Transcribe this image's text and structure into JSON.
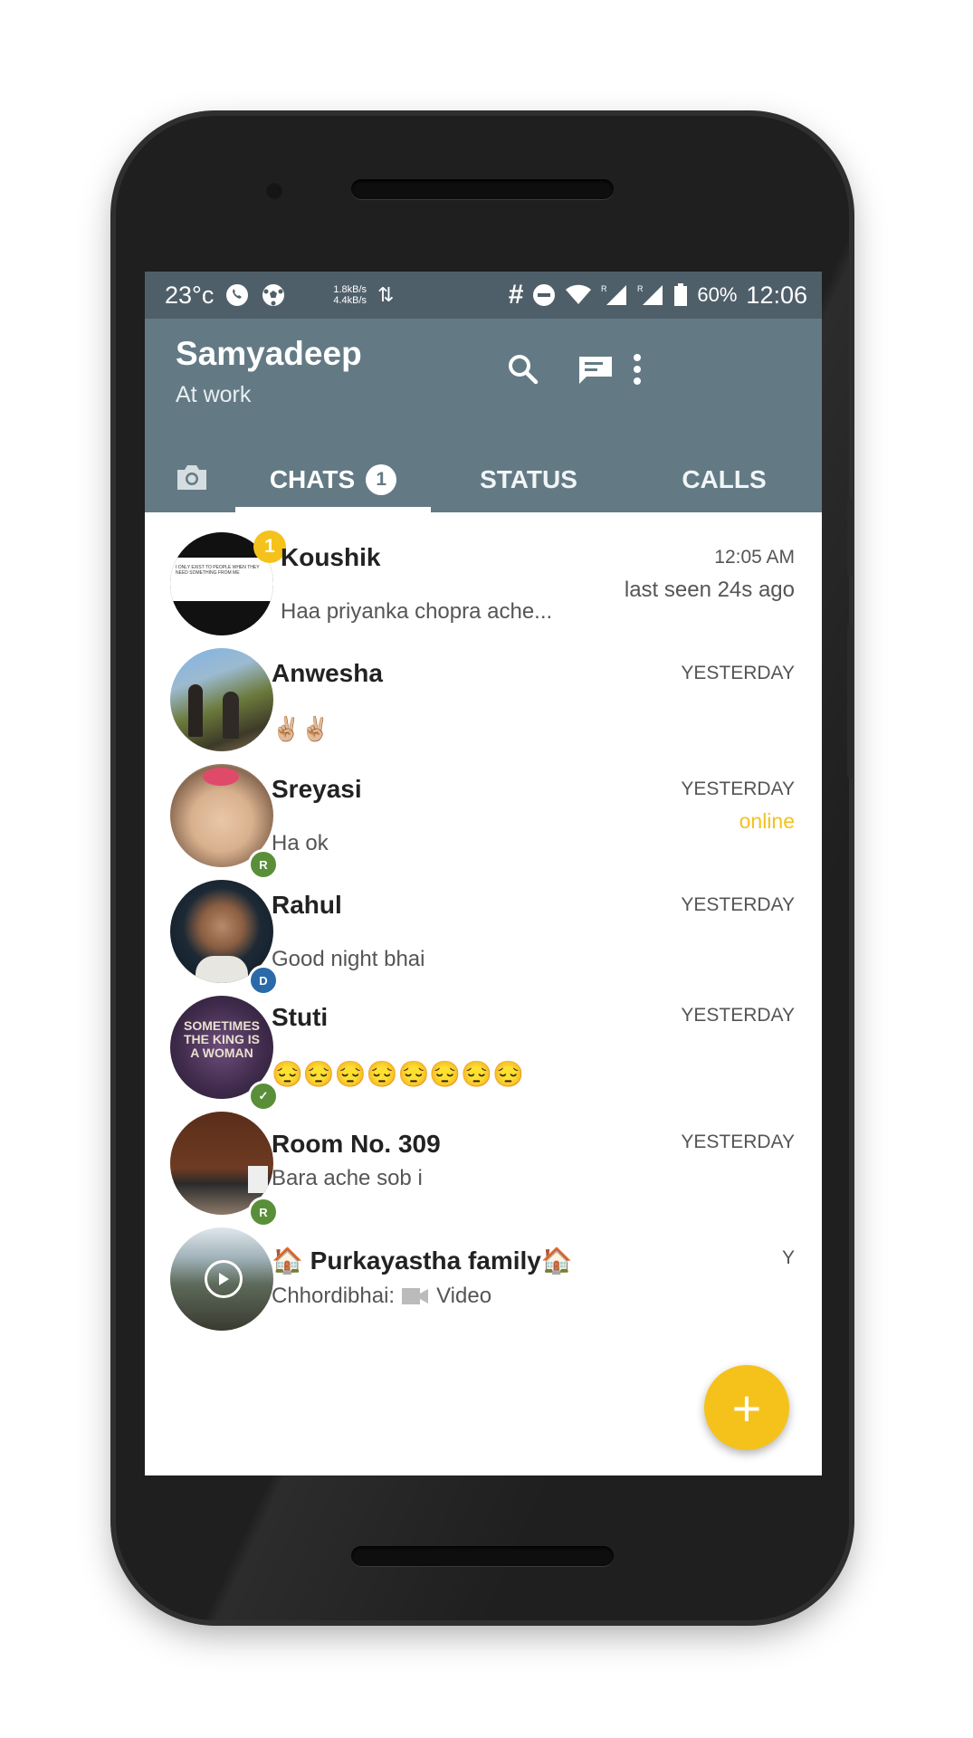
{
  "status_bar": {
    "temperature": "23°c",
    "net_up": "1.8kB/s",
    "net_down": "4.4kB/s",
    "hash": "#",
    "battery": "60%",
    "time": "12:06"
  },
  "app_bar": {
    "title": "Samyadeep",
    "subtitle": "At work",
    "actions": [
      "search-icon",
      "new-chat-icon",
      "more-icon"
    ]
  },
  "tabs": [
    {
      "label": "CHATS",
      "badge": "1",
      "active": true
    },
    {
      "label": "STATUS",
      "active": false
    },
    {
      "label": "CALLS",
      "active": false
    }
  ],
  "chats": [
    {
      "name": "Koushik",
      "preview": "Haa priyanka chopra ache...",
      "time": "12:05 AM",
      "sub": "last seen 24s ago",
      "unread": "1",
      "avatar_text": "I ONLY EXIST TO PEOPLE WHEN THEY NEED SOMETHING FROM ME"
    },
    {
      "name": "Anwesha",
      "preview": "✌🏼✌🏼",
      "time": "YESTERDAY"
    },
    {
      "name": "Sreyasi",
      "preview": "Ha ok",
      "time": "YESTERDAY",
      "sub": "online",
      "avatar_badge": "R"
    },
    {
      "name": "Rahul",
      "preview": "Good night bhai",
      "time": "YESTERDAY",
      "avatar_badge": "D"
    },
    {
      "name": "Stuti",
      "preview": "😔😔😔😔😔😔😔😔",
      "time": "YESTERDAY",
      "avatar_badge": "✓",
      "avatar_text": "SOMETIMES THE KING IS A WOMAN"
    },
    {
      "name": "Room No. 309",
      "preview": "Bara ache sob i",
      "time": "YESTERDAY",
      "avatar_badge": "R"
    },
    {
      "name": "🏠 Purkayastha family🏠",
      "preview_sender": "Chhordibhai:",
      "preview_media": "Video",
      "time": "Y"
    }
  ],
  "fab": {
    "label": "+"
  },
  "colors": {
    "status_bar": "#4f5f69",
    "app_bar": "#637a85",
    "accent": "#f5c21b",
    "badge_green": "#5a8f3a",
    "badge_blue": "#2b6aa8"
  }
}
